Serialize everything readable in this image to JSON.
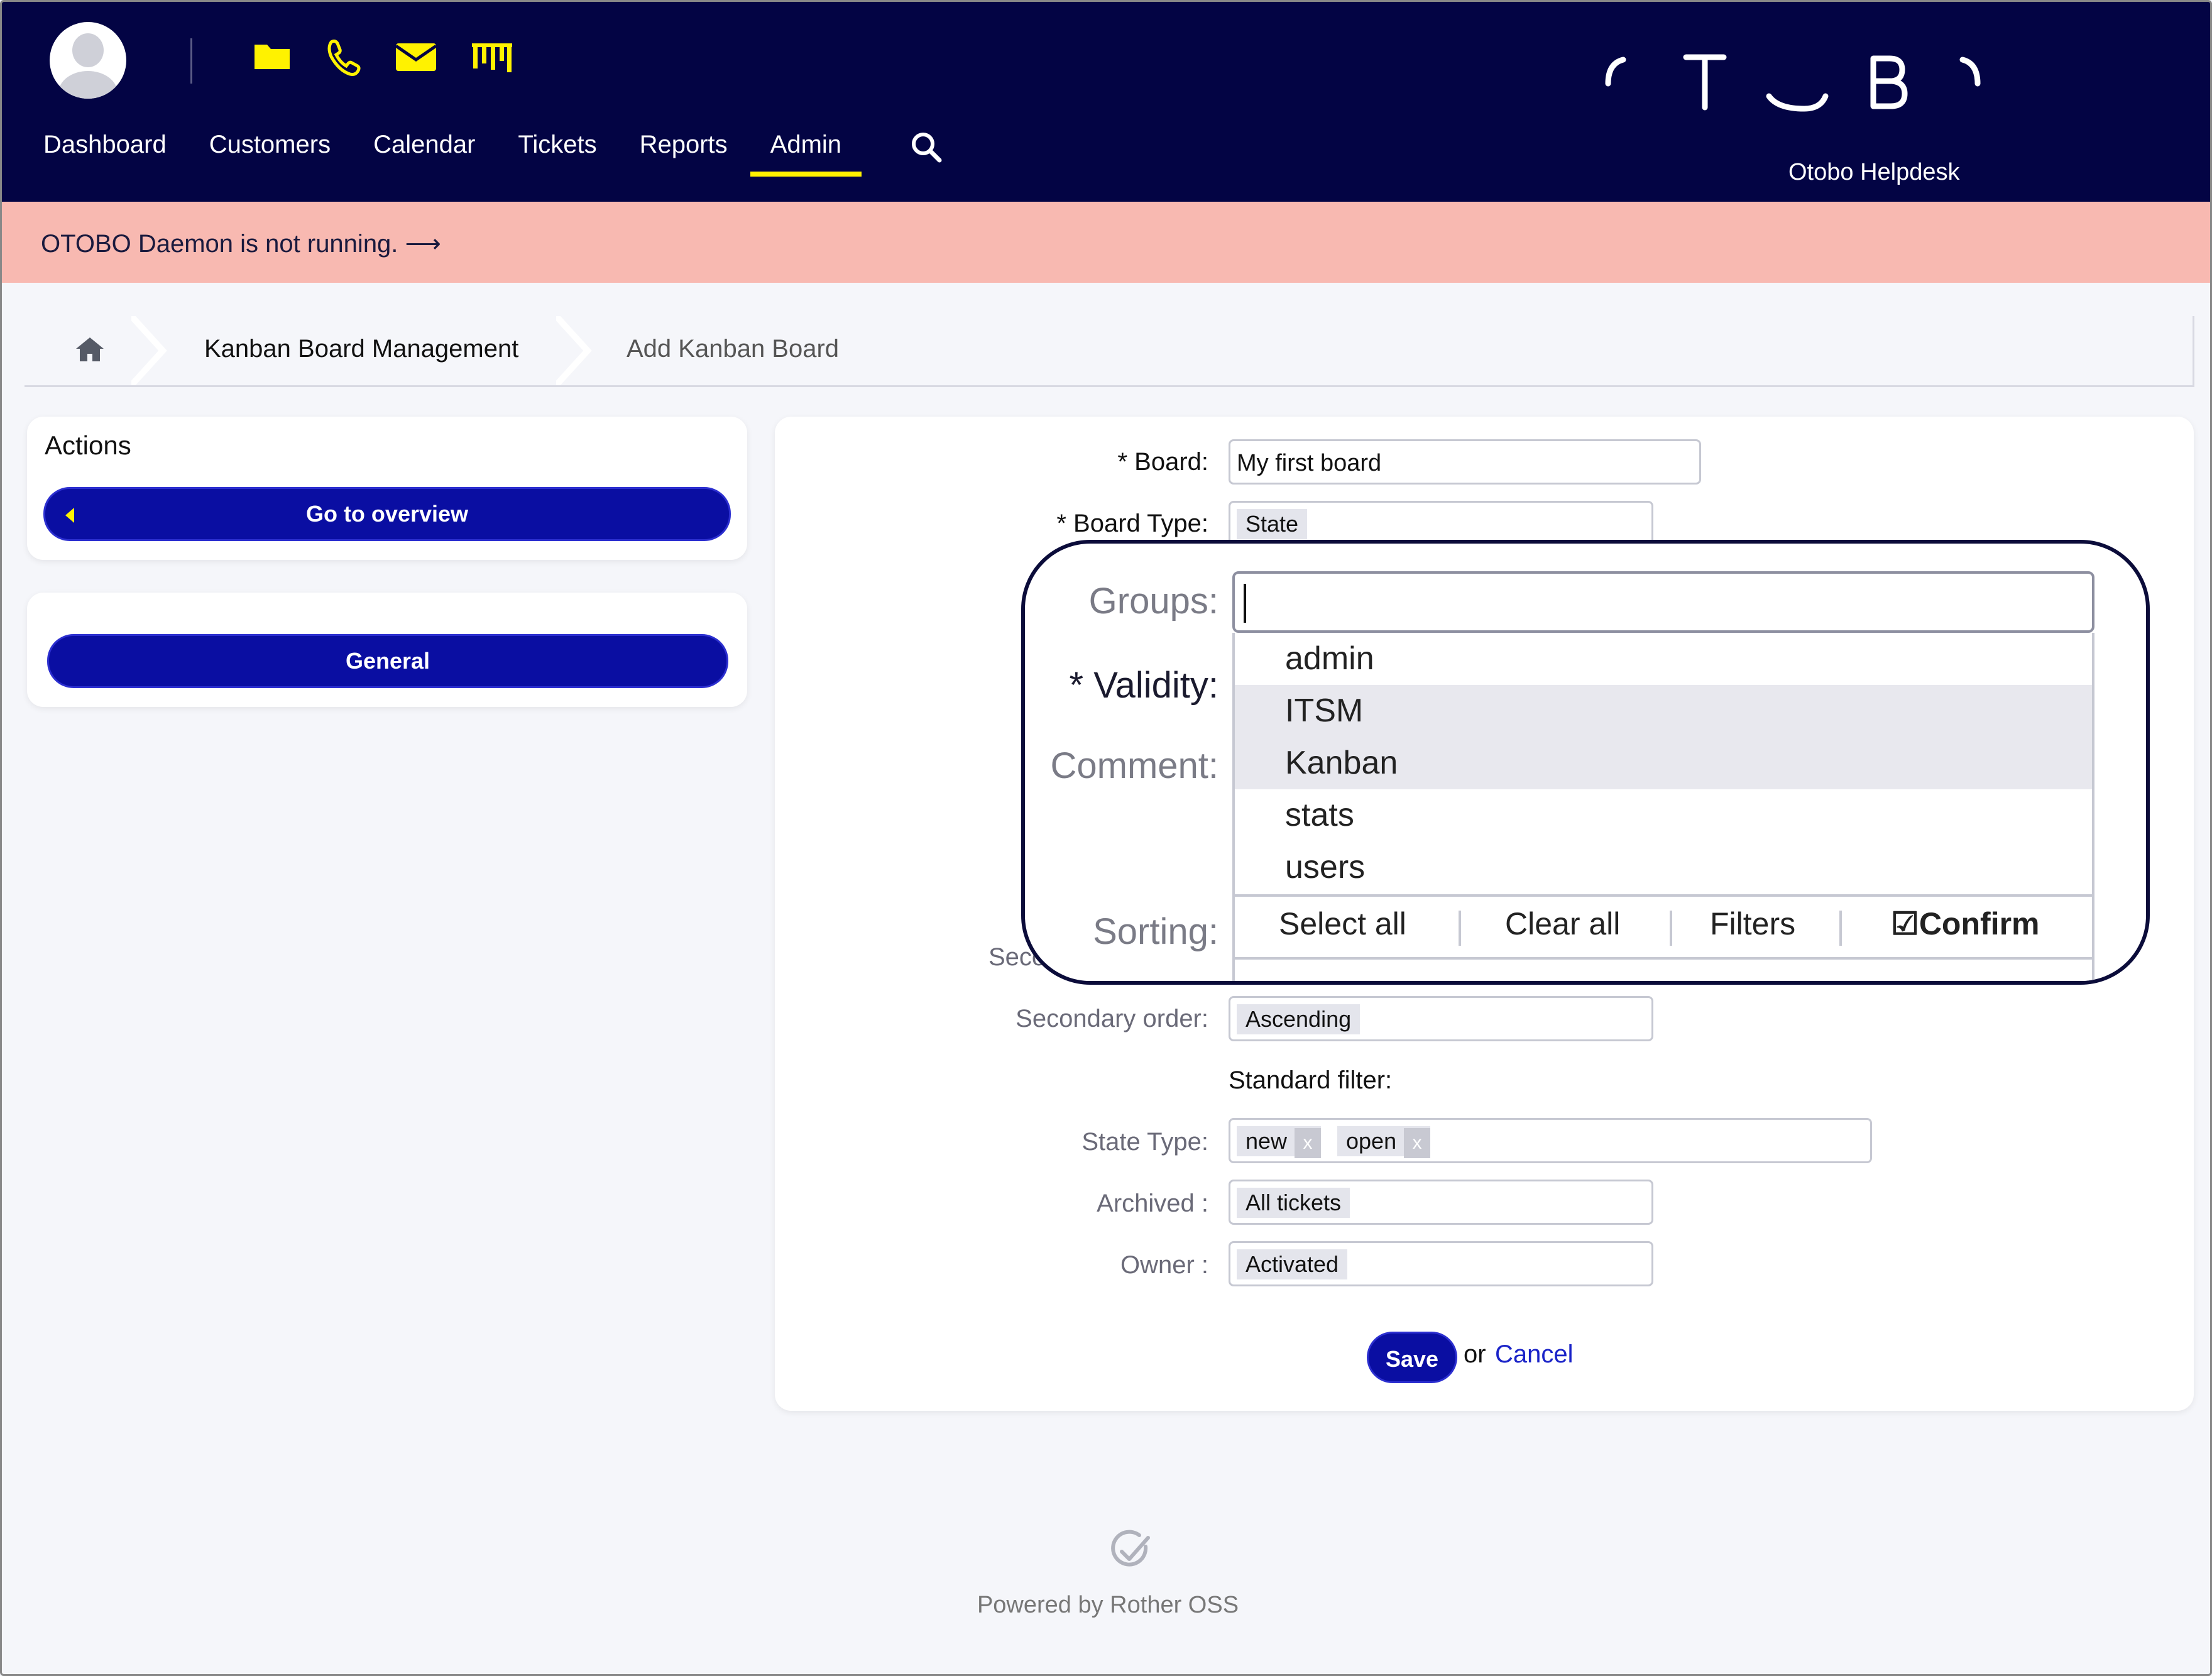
{
  "header": {
    "nav": [
      "Dashboard",
      "Customers",
      "Calendar",
      "Tickets",
      "Reports",
      "Admin"
    ],
    "active_nav": "Admin",
    "brand": "Otobo Helpdesk",
    "quick_icons": [
      "folder-icon",
      "phone-icon",
      "mail-icon",
      "kanban-icon"
    ],
    "accent_color": "#fff200",
    "bg_color": "#030444"
  },
  "notice": {
    "text": "OTOBO Daemon is not running. ⟶",
    "bg_color": "#f8b9b1"
  },
  "breadcrumb": {
    "items": [
      "Kanban Board Management",
      "Add Kanban Board"
    ]
  },
  "sidebar": {
    "actions_title": "Actions",
    "overview_button": "Go to overview",
    "general_button": "General"
  },
  "form": {
    "board_label": "Board:",
    "board_value": "My first board",
    "board_type_label": "Board Type:",
    "board_type_value": "State",
    "groups_label": "Groups:",
    "validity_label": "Validity:",
    "comment_label": "Comment:",
    "sorting_label": "Sorting:",
    "secondary_label_partial": "Seco",
    "secondary_order_label": "Secondary order:",
    "secondary_order_value": "Ascending",
    "standard_filter_label": "Standard filter:",
    "state_type_label": "State Type:",
    "state_type_tags": [
      "new",
      "open"
    ],
    "archived_label": "Archived :",
    "archived_value": "All tickets",
    "owner_label": "Owner :",
    "owner_value": "Activated",
    "required_mark": "*",
    "save_label": "Save",
    "or_text": "or",
    "cancel_label": "Cancel"
  },
  "groups_dropdown": {
    "search_value": "",
    "options": [
      "admin",
      "ITSM",
      "Kanban",
      "stats",
      "users"
    ],
    "highlighted": [
      "ITSM",
      "Kanban"
    ],
    "actions": [
      "Select all",
      "Clear all",
      "Filters",
      "Confirm"
    ],
    "confirm_icon": "☑"
  },
  "footer": {
    "text": "Powered by Rother OSS"
  }
}
